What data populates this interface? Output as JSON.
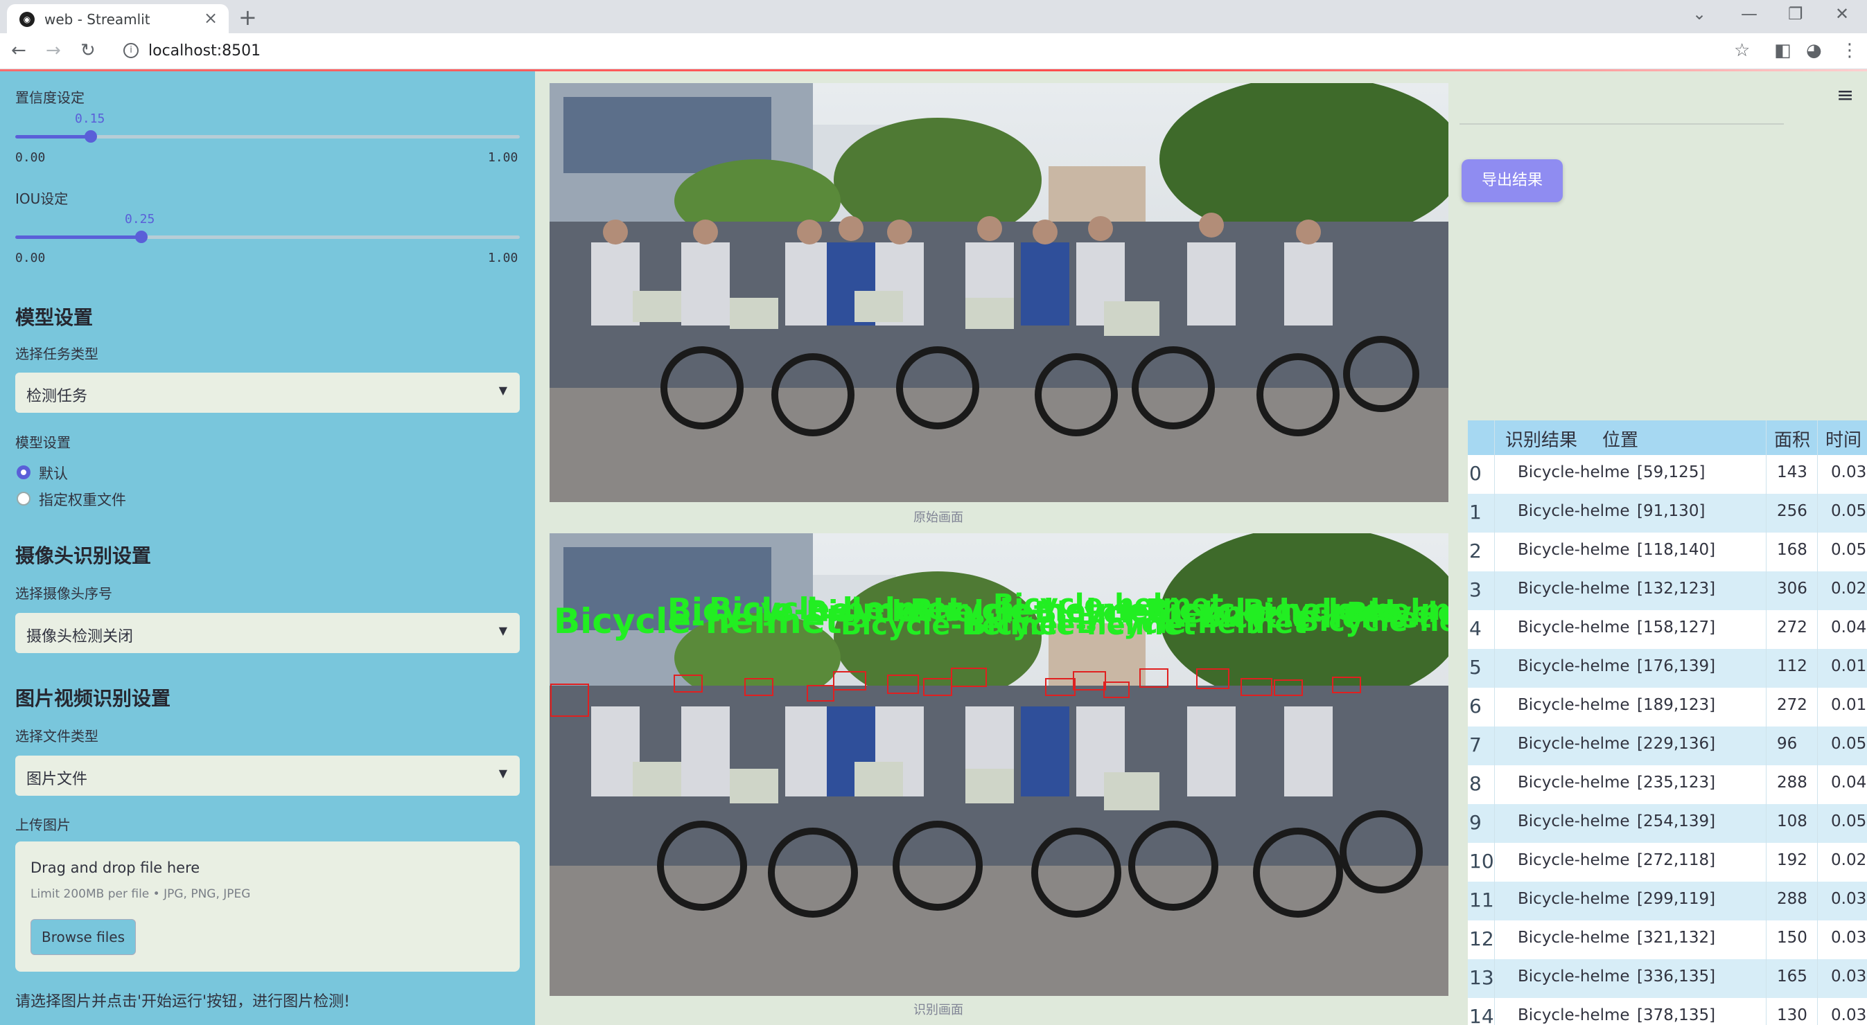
{
  "browser": {
    "tab_title": "web - Streamlit",
    "url": "localhost:8501"
  },
  "sidebar": {
    "confidence": {
      "label": "置信度设定",
      "value": "0.15",
      "value_num": 0.15,
      "min": "0.00",
      "max": "1.00"
    },
    "iou": {
      "label": "IOU设定",
      "value": "0.25",
      "value_num": 0.25,
      "min": "0.00",
      "max": "1.00"
    },
    "model_section": {
      "title": "模型设置",
      "task_label": "选择任务类型",
      "task_value": "检测任务",
      "model_label": "模型设置",
      "radio_default": "默认",
      "radio_custom": "指定权重文件"
    },
    "camera_section": {
      "title": "摄像头识别设置",
      "camera_label": "选择摄像头序号",
      "camera_value": "摄像头检测关闭"
    },
    "media_section": {
      "title": "图片视频识别设置",
      "file_type_label": "选择文件类型",
      "file_type_value": "图片文件",
      "upload_label": "上传图片",
      "drop_text": "Drag and drop file here",
      "limit_text": "Limit 200MB per file • JPG, PNG, JPEG",
      "browse_label": "Browse files"
    },
    "hint": "请选择图片并点击'开始运行'按钮，进行图片检测!"
  },
  "main": {
    "original_caption": "原始画面",
    "result_caption": "识别画面",
    "overlay_text": "Bicycle-helmet",
    "export_label": "导出结果"
  },
  "table": {
    "headers": [
      "识别结果",
      "位置",
      "面积",
      "时间"
    ],
    "rows": [
      {
        "idx": "0",
        "name": "Bicycle-helme",
        "pos": "[59,125]",
        "area": "143",
        "time": "0.03"
      },
      {
        "idx": "1",
        "name": "Bicycle-helme",
        "pos": "[91,130]",
        "area": "256",
        "time": "0.05"
      },
      {
        "idx": "2",
        "name": "Bicycle-helme",
        "pos": "[118,140]",
        "area": "168",
        "time": "0.05"
      },
      {
        "idx": "3",
        "name": "Bicycle-helme",
        "pos": "[132,123]",
        "area": "306",
        "time": "0.02"
      },
      {
        "idx": "4",
        "name": "Bicycle-helme",
        "pos": "[158,127]",
        "area": "272",
        "time": "0.04"
      },
      {
        "idx": "5",
        "name": "Bicycle-helme",
        "pos": "[176,139]",
        "area": "112",
        "time": "0.01"
      },
      {
        "idx": "6",
        "name": "Bicycle-helme",
        "pos": "[189,123]",
        "area": "272",
        "time": "0.01"
      },
      {
        "idx": "7",
        "name": "Bicycle-helme",
        "pos": "[229,136]",
        "area": "96",
        "time": "0.05"
      },
      {
        "idx": "8",
        "name": "Bicycle-helme",
        "pos": "[235,123]",
        "area": "288",
        "time": "0.04"
      },
      {
        "idx": "9",
        "name": "Bicycle-helme",
        "pos": "[254,139]",
        "area": "108",
        "time": "0.05"
      },
      {
        "idx": "10",
        "name": "Bicycle-helme",
        "pos": "[272,118]",
        "area": "192",
        "time": "0.02"
      },
      {
        "idx": "11",
        "name": "Bicycle-helme",
        "pos": "[299,119]",
        "area": "288",
        "time": "0.03"
      },
      {
        "idx": "12",
        "name": "Bicycle-helme",
        "pos": "[321,132]",
        "area": "150",
        "time": "0.03"
      },
      {
        "idx": "13",
        "name": "Bicycle-helme",
        "pos": "[336,135]",
        "area": "165",
        "time": "0.03"
      },
      {
        "idx": "14",
        "name": "Bicycle-helme",
        "pos": "[378,135]",
        "area": "130",
        "time": "0.03"
      }
    ]
  },
  "colors": {
    "sidebar": "#79c6dc",
    "accent": "#5a5fd8",
    "export": "#8f8cf1",
    "detect_box": "#e02020",
    "detect_text": "#22ee22"
  }
}
